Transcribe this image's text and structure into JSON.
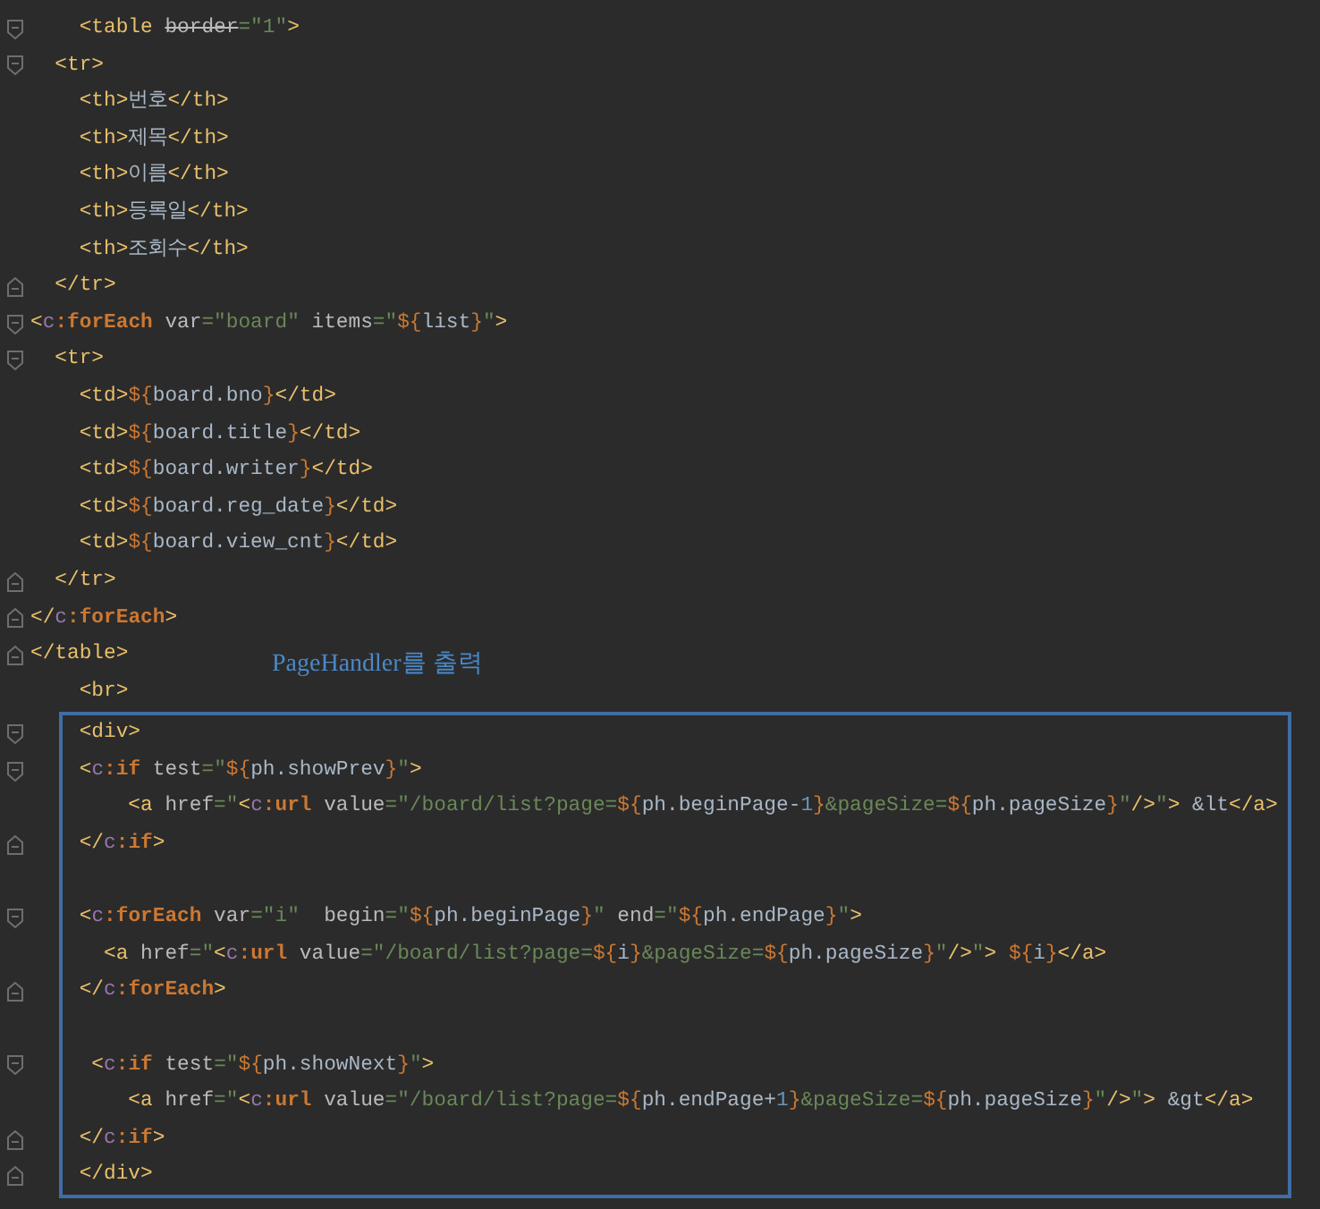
{
  "editor": {
    "lines": [
      {
        "kind": "fold_open",
        "tokens": [
          {
            "kind": "tag",
            "t": "    <table "
          },
          {
            "kind": "deprecated",
            "t": "border"
          },
          {
            "kind": "str",
            "t": "=\"1\""
          },
          {
            "kind": "tag",
            "t": ">"
          }
        ]
      },
      {
        "kind": "fold_open",
        "tokens": [
          {
            "kind": "tag",
            "t": "  <tr>"
          }
        ]
      },
      {
        "kind": "plain",
        "tokens": [
          {
            "kind": "tag",
            "t": "    <th>"
          },
          {
            "kind": "text",
            "t": "번호"
          },
          {
            "kind": "tag",
            "t": "</th>"
          }
        ]
      },
      {
        "kind": "plain",
        "tokens": [
          {
            "kind": "tag",
            "t": "    <th>"
          },
          {
            "kind": "text",
            "t": "제목"
          },
          {
            "kind": "tag",
            "t": "</th>"
          }
        ]
      },
      {
        "kind": "plain",
        "tokens": [
          {
            "kind": "tag",
            "t": "    <th>"
          },
          {
            "kind": "text",
            "t": "이름"
          },
          {
            "kind": "tag",
            "t": "</th>"
          }
        ]
      },
      {
        "kind": "plain",
        "tokens": [
          {
            "kind": "tag",
            "t": "    <th>"
          },
          {
            "kind": "text",
            "t": "등록일"
          },
          {
            "kind": "tag",
            "t": "</th>"
          }
        ]
      },
      {
        "kind": "plain",
        "tokens": [
          {
            "kind": "tag",
            "t": "    <th>"
          },
          {
            "kind": "text",
            "t": "조회수"
          },
          {
            "kind": "tag",
            "t": "</th>"
          }
        ]
      },
      {
        "kind": "fold_close",
        "tokens": [
          {
            "kind": "tag",
            "t": "  </tr>"
          }
        ]
      },
      {
        "kind": "fold_open",
        "tokens": [
          {
            "kind": "tag",
            "t": "<"
          },
          {
            "kind": "ns",
            "t": "c"
          },
          {
            "kind": "jstl",
            "t": ":forEach"
          },
          {
            "kind": "attr",
            "t": " var"
          },
          {
            "kind": "str",
            "t": "=\"board\""
          },
          {
            "kind": "attr",
            "t": " items"
          },
          {
            "kind": "str",
            "t": "=\""
          },
          {
            "kind": "brace",
            "t": "${"
          },
          {
            "kind": "expr",
            "t": "list"
          },
          {
            "kind": "brace",
            "t": "}"
          },
          {
            "kind": "str",
            "t": "\""
          },
          {
            "kind": "tag",
            "t": ">"
          }
        ]
      },
      {
        "kind": "fold_open",
        "tokens": [
          {
            "kind": "tag",
            "t": "  <tr>"
          }
        ]
      },
      {
        "kind": "plain",
        "tokens": [
          {
            "kind": "tag",
            "t": "    <td>"
          },
          {
            "kind": "brace",
            "t": "${"
          },
          {
            "kind": "expr",
            "t": "board.bno"
          },
          {
            "kind": "brace",
            "t": "}"
          },
          {
            "kind": "tag",
            "t": "</td>"
          }
        ]
      },
      {
        "kind": "plain",
        "tokens": [
          {
            "kind": "tag",
            "t": "    <td>"
          },
          {
            "kind": "brace",
            "t": "${"
          },
          {
            "kind": "expr",
            "t": "board.title"
          },
          {
            "kind": "brace",
            "t": "}"
          },
          {
            "kind": "tag",
            "t": "</td>"
          }
        ]
      },
      {
        "kind": "plain",
        "tokens": [
          {
            "kind": "tag",
            "t": "    <td>"
          },
          {
            "kind": "brace",
            "t": "${"
          },
          {
            "kind": "expr",
            "t": "board.writer"
          },
          {
            "kind": "brace",
            "t": "}"
          },
          {
            "kind": "tag",
            "t": "</td>"
          }
        ]
      },
      {
        "kind": "plain",
        "tokens": [
          {
            "kind": "tag",
            "t": "    <td>"
          },
          {
            "kind": "brace",
            "t": "${"
          },
          {
            "kind": "expr",
            "t": "board.reg_date"
          },
          {
            "kind": "brace",
            "t": "}"
          },
          {
            "kind": "tag",
            "t": "</td>"
          }
        ]
      },
      {
        "kind": "plain",
        "tokens": [
          {
            "kind": "tag",
            "t": "    <td>"
          },
          {
            "kind": "brace",
            "t": "${"
          },
          {
            "kind": "expr",
            "t": "board.view_cnt"
          },
          {
            "kind": "brace",
            "t": "}"
          },
          {
            "kind": "tag",
            "t": "</td>"
          }
        ]
      },
      {
        "kind": "fold_close",
        "tokens": [
          {
            "kind": "tag",
            "t": "  </tr>"
          }
        ]
      },
      {
        "kind": "fold_close",
        "tokens": [
          {
            "kind": "tag",
            "t": "</"
          },
          {
            "kind": "ns",
            "t": "c"
          },
          {
            "kind": "jstl",
            "t": ":forEach"
          },
          {
            "kind": "tag",
            "t": ">"
          }
        ]
      },
      {
        "kind": "fold_close",
        "tokens": [
          {
            "kind": "tag",
            "t": "</table>"
          }
        ]
      },
      {
        "kind": "plain",
        "tokens": [
          {
            "kind": "tag",
            "t": "    <br>"
          }
        ]
      }
    ]
  },
  "annotation": "PageHandler를 출력",
  "highlight_box": {
    "lines": [
      {
        "kind": "fold_open",
        "tokens": [
          {
            "kind": "tag",
            "t": "    <div>"
          }
        ]
      },
      {
        "kind": "fold_open",
        "tokens": [
          {
            "kind": "tag",
            "t": "    <"
          },
          {
            "kind": "ns",
            "t": "c"
          },
          {
            "kind": "jstl",
            "t": ":if"
          },
          {
            "kind": "attr",
            "t": " test"
          },
          {
            "kind": "str",
            "t": "=\""
          },
          {
            "kind": "brace",
            "t": "${"
          },
          {
            "kind": "expr",
            "t": "ph.showPrev"
          },
          {
            "kind": "brace",
            "t": "}"
          },
          {
            "kind": "str",
            "t": "\""
          },
          {
            "kind": "tag",
            "t": ">"
          }
        ]
      },
      {
        "kind": "plain",
        "tokens": [
          {
            "kind": "tag",
            "t": "        <a"
          },
          {
            "kind": "attr",
            "t": " href"
          },
          {
            "kind": "str",
            "t": "=\""
          },
          {
            "kind": "tag",
            "t": "<"
          },
          {
            "kind": "ns",
            "t": "c"
          },
          {
            "kind": "jstl",
            "t": ":url"
          },
          {
            "kind": "attr",
            "t": " value"
          },
          {
            "kind": "str",
            "t": "=\"/board/list?page="
          },
          {
            "kind": "brace",
            "t": "${"
          },
          {
            "kind": "expr",
            "t": "ph.beginPage-"
          },
          {
            "kind": "num",
            "t": "1"
          },
          {
            "kind": "brace",
            "t": "}"
          },
          {
            "kind": "str",
            "t": "&pageSize="
          },
          {
            "kind": "brace",
            "t": "${"
          },
          {
            "kind": "expr",
            "t": "ph.pageSize"
          },
          {
            "kind": "brace",
            "t": "}"
          },
          {
            "kind": "str",
            "t": "\""
          },
          {
            "kind": "tag",
            "t": "/>"
          },
          {
            "kind": "str",
            "t": "\""
          },
          {
            "kind": "tag",
            "t": ">"
          },
          {
            "kind": "text",
            "t": " &lt"
          },
          {
            "kind": "tag",
            "t": "</a>"
          }
        ]
      },
      {
        "kind": "fold_close",
        "tokens": [
          {
            "kind": "tag",
            "t": "    </"
          },
          {
            "kind": "ns",
            "t": "c"
          },
          {
            "kind": "jstl",
            "t": ":if"
          },
          {
            "kind": "tag",
            "t": ">"
          }
        ]
      },
      {
        "kind": "plain"
      },
      {
        "kind": "fold_open",
        "tokens": [
          {
            "kind": "tag",
            "t": "    <"
          },
          {
            "kind": "ns",
            "t": "c"
          },
          {
            "kind": "jstl",
            "t": ":forEach"
          },
          {
            "kind": "attr",
            "t": " var"
          },
          {
            "kind": "str",
            "t": "=\"i\""
          },
          {
            "kind": "attr",
            "t": "  begin"
          },
          {
            "kind": "str",
            "t": "=\""
          },
          {
            "kind": "brace",
            "t": "${"
          },
          {
            "kind": "expr",
            "t": "ph.beginPage"
          },
          {
            "kind": "brace",
            "t": "}"
          },
          {
            "kind": "str",
            "t": "\""
          },
          {
            "kind": "attr",
            "t": " end"
          },
          {
            "kind": "str",
            "t": "=\""
          },
          {
            "kind": "brace",
            "t": "${"
          },
          {
            "kind": "expr",
            "t": "ph.endPage"
          },
          {
            "kind": "brace",
            "t": "}"
          },
          {
            "kind": "str",
            "t": "\""
          },
          {
            "kind": "tag",
            "t": ">"
          }
        ]
      },
      {
        "kind": "plain",
        "tokens": [
          {
            "kind": "tag",
            "t": "      <a"
          },
          {
            "kind": "attr",
            "t": " href"
          },
          {
            "kind": "str",
            "t": "=\""
          },
          {
            "kind": "tag",
            "t": "<"
          },
          {
            "kind": "ns",
            "t": "c"
          },
          {
            "kind": "jstl",
            "t": ":url"
          },
          {
            "kind": "attr",
            "t": " value"
          },
          {
            "kind": "str",
            "t": "=\"/board/list?page="
          },
          {
            "kind": "brace",
            "t": "${"
          },
          {
            "kind": "expr",
            "t": "i"
          },
          {
            "kind": "brace",
            "t": "}"
          },
          {
            "kind": "str",
            "t": "&pageSize="
          },
          {
            "kind": "brace",
            "t": "${"
          },
          {
            "kind": "expr",
            "t": "ph.pageSize"
          },
          {
            "kind": "brace",
            "t": "}"
          },
          {
            "kind": "str",
            "t": "\""
          },
          {
            "kind": "tag",
            "t": "/>"
          },
          {
            "kind": "str",
            "t": "\""
          },
          {
            "kind": "tag",
            "t": "> "
          },
          {
            "kind": "brace",
            "t": "${"
          },
          {
            "kind": "expr",
            "t": "i"
          },
          {
            "kind": "brace",
            "t": "}"
          },
          {
            "kind": "tag",
            "t": "</a>"
          }
        ]
      },
      {
        "kind": "fold_close",
        "tokens": [
          {
            "kind": "tag",
            "t": "    </"
          },
          {
            "kind": "ns",
            "t": "c"
          },
          {
            "kind": "jstl",
            "t": ":forEach"
          },
          {
            "kind": "tag",
            "t": ">"
          }
        ]
      },
      {
        "kind": "plain"
      },
      {
        "kind": "fold_open",
        "tokens": [
          {
            "kind": "tag",
            "t": "     <"
          },
          {
            "kind": "ns",
            "t": "c"
          },
          {
            "kind": "jstl",
            "t": ":if"
          },
          {
            "kind": "attr",
            "t": " test"
          },
          {
            "kind": "str",
            "t": "=\""
          },
          {
            "kind": "brace",
            "t": "${"
          },
          {
            "kind": "expr",
            "t": "ph.showNext"
          },
          {
            "kind": "brace",
            "t": "}"
          },
          {
            "kind": "str",
            "t": "\""
          },
          {
            "kind": "tag",
            "t": ">"
          }
        ]
      },
      {
        "kind": "plain",
        "tokens": [
          {
            "kind": "tag",
            "t": "        <a"
          },
          {
            "kind": "attr",
            "t": " href"
          },
          {
            "kind": "str",
            "t": "=\""
          },
          {
            "kind": "tag",
            "t": "<"
          },
          {
            "kind": "ns",
            "t": "c"
          },
          {
            "kind": "jstl",
            "t": ":url"
          },
          {
            "kind": "attr",
            "t": " value"
          },
          {
            "kind": "str",
            "t": "=\"/board/list?page="
          },
          {
            "kind": "brace",
            "t": "${"
          },
          {
            "kind": "expr",
            "t": "ph.endPage+"
          },
          {
            "kind": "num",
            "t": "1"
          },
          {
            "kind": "brace",
            "t": "}"
          },
          {
            "kind": "str",
            "t": "&pageSize="
          },
          {
            "kind": "brace",
            "t": "${"
          },
          {
            "kind": "expr",
            "t": "ph.pageSize"
          },
          {
            "kind": "brace",
            "t": "}"
          },
          {
            "kind": "str",
            "t": "\""
          },
          {
            "kind": "tag",
            "t": "/>"
          },
          {
            "kind": "str",
            "t": "\""
          },
          {
            "kind": "tag",
            "t": ">"
          },
          {
            "kind": "text",
            "t": " &gt"
          },
          {
            "kind": "tag",
            "t": "</a>"
          }
        ]
      },
      {
        "kind": "fold_close",
        "tokens": [
          {
            "kind": "tag",
            "t": "    </"
          },
          {
            "kind": "ns",
            "t": "c"
          },
          {
            "kind": "jstl",
            "t": ":if"
          },
          {
            "kind": "tag",
            "t": ">"
          }
        ]
      },
      {
        "kind": "fold_close",
        "tokens": [
          {
            "kind": "tag",
            "t": "    </div>"
          }
        ]
      }
    ]
  }
}
